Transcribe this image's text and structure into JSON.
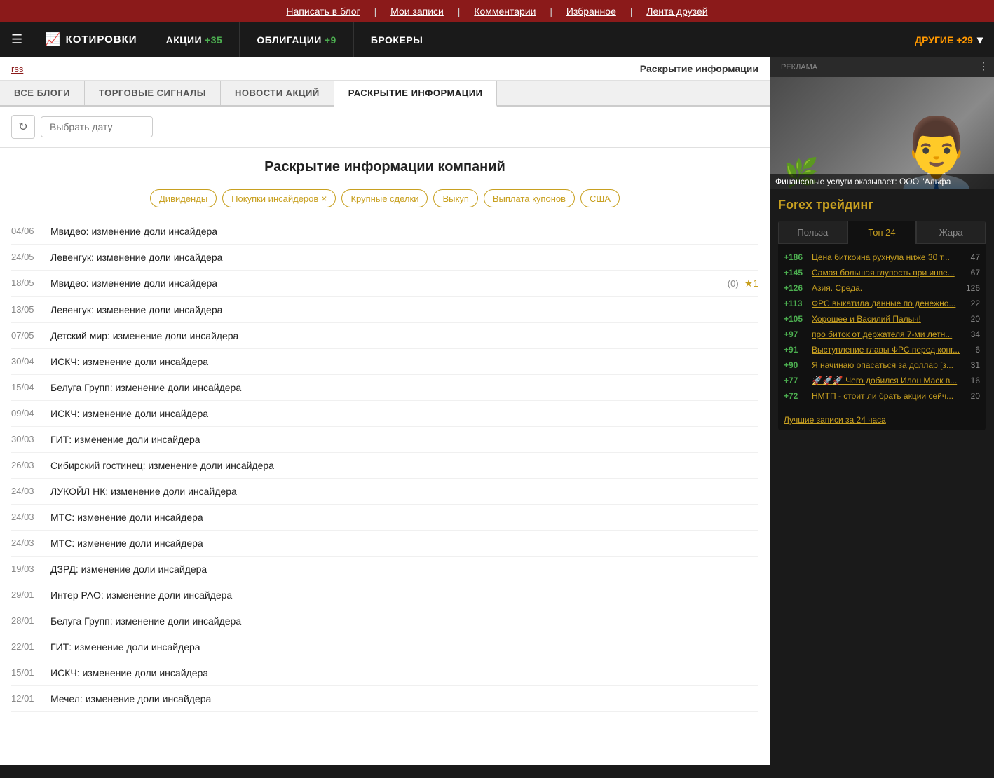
{
  "topbar": {
    "links": [
      "Написать в блог",
      "Мои записи",
      "Комментарии",
      "Избранное",
      "Лента друзей"
    ]
  },
  "navbar": {
    "logo": "КОТИРОВКИ",
    "items": [
      {
        "label": "АКЦИИ",
        "count": "+35",
        "count_class": "green"
      },
      {
        "label": "ОБЛИГАЦИИ",
        "count": "+9",
        "count_class": "green"
      },
      {
        "label": "БРОКЕРЫ",
        "count": "",
        "count_class": ""
      },
      {
        "label": "ДРУГИЕ",
        "count": "+29",
        "count_class": "orange"
      }
    ]
  },
  "page": {
    "rss_label": "rss",
    "page_title": "Раскрытие информации",
    "tabs": [
      {
        "label": "ВСЕ БЛОГИ",
        "active": false
      },
      {
        "label": "ТОРГОВЫЕ СИГНАЛЫ",
        "active": false
      },
      {
        "label": "НОВОСТИ АКЦИЙ",
        "active": false
      },
      {
        "label": "РАСКРЫТИЕ ИНФОРМАЦИИ",
        "active": true
      }
    ],
    "date_placeholder": "Выбрать дату",
    "section_title": "Раскрытие информации компаний",
    "chips": [
      {
        "label": "Дивиденды",
        "closable": false
      },
      {
        "label": "Покупки инсайдеров",
        "closable": true
      },
      {
        "label": "Крупные сделки",
        "closable": false
      },
      {
        "label": "Выкуп",
        "closable": false
      },
      {
        "label": "Выплата купонов",
        "closable": false
      },
      {
        "label": "США",
        "closable": false
      }
    ],
    "news": [
      {
        "date": "04/06",
        "text": "Мвидео: изменение доли инсайдера",
        "meta": "",
        "star": false
      },
      {
        "date": "24/05",
        "text": "Левенгук: изменение доли инсайдера",
        "meta": "",
        "star": false
      },
      {
        "date": "18/05",
        "text": "Мвидео: изменение доли инсайдера",
        "meta": "(0)",
        "star": true
      },
      {
        "date": "13/05",
        "text": "Левенгук: изменение доли инсайдера",
        "meta": "",
        "star": false
      },
      {
        "date": "07/05",
        "text": "Детский мир: изменение доли инсайдера",
        "meta": "",
        "star": false
      },
      {
        "date": "30/04",
        "text": "ИСКЧ: изменение доли инсайдера",
        "meta": "",
        "star": false
      },
      {
        "date": "15/04",
        "text": "Белуга Групп: изменение доли инсайдера",
        "meta": "",
        "star": false
      },
      {
        "date": "09/04",
        "text": "ИСКЧ: изменение доли инсайдера",
        "meta": "",
        "star": false
      },
      {
        "date": "30/03",
        "text": "ГИТ: изменение доли инсайдера",
        "meta": "",
        "star": false
      },
      {
        "date": "26/03",
        "text": "Сибирский гостинец: изменение доли инсайдера",
        "meta": "",
        "star": false
      },
      {
        "date": "24/03",
        "text": "ЛУКОЙЛ НК: изменение доли инсайдера",
        "meta": "",
        "star": false
      },
      {
        "date": "24/03",
        "text": "МТС: изменение доли инсайдера",
        "meta": "",
        "star": false
      },
      {
        "date": "24/03",
        "text": "МТС: изменение доли инсайдера",
        "meta": "",
        "star": false
      },
      {
        "date": "19/03",
        "text": "ДЗРД: изменение доли инсайдера",
        "meta": "",
        "star": false
      },
      {
        "date": "29/01",
        "text": "Интер РАО: изменение доли инсайдера",
        "meta": "",
        "star": false
      },
      {
        "date": "28/01",
        "text": "Белуга Групп: изменение доли инсайдера",
        "meta": "",
        "star": false
      },
      {
        "date": "22/01",
        "text": "ГИТ: изменение доли инсайдера",
        "meta": "",
        "star": false
      },
      {
        "date": "15/01",
        "text": "ИСКЧ: изменение доли инсайдера",
        "meta": "",
        "star": false
      },
      {
        "date": "12/01",
        "text": "Мечел: изменение доли инсайдера",
        "meta": "",
        "star": false
      }
    ]
  },
  "sidebar": {
    "ad_label": "РЕКЛАМА",
    "ad_caption": "Финансовые услуги оказывает: ООО \"Альфа",
    "forex_title": "Forex трейдинг",
    "widget": {
      "tabs": [
        "Польза",
        "Топ 24",
        "Жара"
      ],
      "active_tab": 1,
      "rows": [
        {
          "score": "+186",
          "link": "Цена биткоина рухнула ниже 30 т...",
          "count": "47"
        },
        {
          "score": "+145",
          "link": "Самая большая глупость при инве...",
          "count": "67"
        },
        {
          "score": "+126",
          "link": "Азия. Среда.",
          "count": "126"
        },
        {
          "score": "+113",
          "link": "ФРС выкатила данные по денежно...",
          "count": "22"
        },
        {
          "score": "+105",
          "link": "Хорошее и Василий Палыч!",
          "count": "20"
        },
        {
          "score": "+97",
          "link": "про биток от держателя 7-ми летн...",
          "count": "34"
        },
        {
          "score": "+91",
          "link": "Выступление главы ФРС перед конг...",
          "count": "6"
        },
        {
          "score": "+90",
          "link": "Я начинаю опасаться за доллар [з...",
          "count": "31"
        },
        {
          "score": "+77",
          "link": "🚀🚀🚀 Чего добился Илон Маск в...",
          "count": "16"
        },
        {
          "score": "+72",
          "link": "НМТП - стоит ли брать акции сейч...",
          "count": "20"
        }
      ],
      "best_link": "Лучшие записи за 24 часа"
    }
  }
}
